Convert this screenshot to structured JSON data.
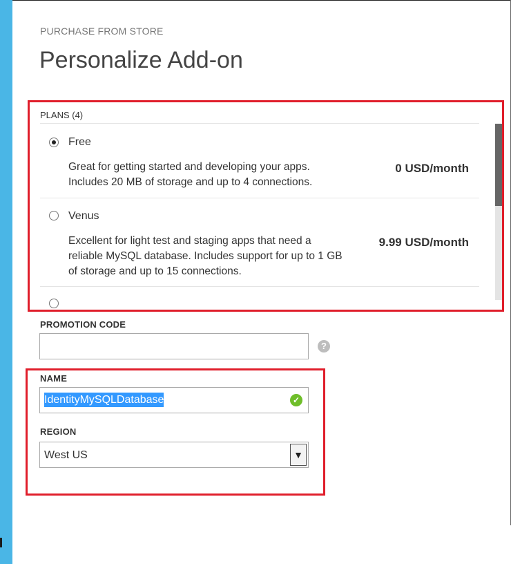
{
  "header": {
    "subtitle": "PURCHASE FROM STORE",
    "title": "Personalize Add-on"
  },
  "plans": {
    "header": "PLANS (4)",
    "items": [
      {
        "name": "Free",
        "description": "Great for getting started and developing your apps. Includes 20 MB of storage and up to 4 connections.",
        "price": "0 USD/month",
        "selected": true
      },
      {
        "name": "Venus",
        "description": "Excellent for light test and staging apps that need a reliable MySQL database. Includes support for up to 1 GB of storage and up to 15 connections.",
        "price": "9.99 USD/month",
        "selected": false
      }
    ]
  },
  "promotion": {
    "label": "PROMOTION CODE",
    "value": "",
    "help_icon": "question-circle-icon"
  },
  "name_field": {
    "label": "NAME",
    "value": "IdentityMySQLDatabase",
    "status_icon": "checkmark-circle-icon"
  },
  "region": {
    "label": "REGION",
    "selected": "West US"
  },
  "colors": {
    "highlight_border": "#e01e2b",
    "accent_strip": "#4ab6e6",
    "selection": "#3399ff",
    "valid": "#6fbe2a"
  }
}
